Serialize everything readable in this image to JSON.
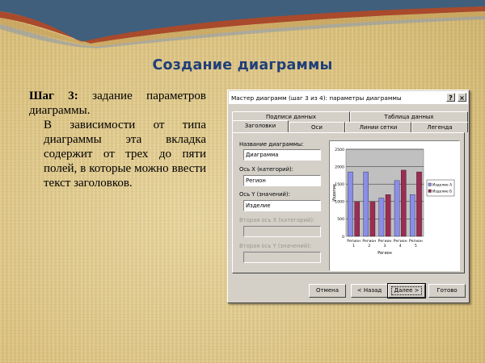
{
  "slide": {
    "title": "Создание диаграммы",
    "step_label": "Шаг 3:",
    "step_text": " задание параметров диаграммы.",
    "paragraph": "В зависимости от типа диаграммы эта вкладка содержит от трех до пяти полей, в которые можно ввести текст заголовков."
  },
  "dialog": {
    "title": "Мастер диаграмм (шаг 3 из 4): параметры диаграммы",
    "help_glyph": "?",
    "close_glyph": "×",
    "tabs_back": [
      "Подписи данных",
      "Таблица данных"
    ],
    "tabs_front": [
      "Заголовки",
      "Оси",
      "Линии сетки",
      "Легенда"
    ],
    "active_tab": "Заголовки",
    "fields": [
      {
        "label": "Название диаграммы:",
        "value": "Диаграмма",
        "enabled": true
      },
      {
        "label": "Ось X (категорий):",
        "value": "Регион",
        "enabled": true
      },
      {
        "label": "Ось Y (значений):",
        "value": "Изделие",
        "enabled": true
      },
      {
        "label": "Вторая ось X (категорий):",
        "value": "",
        "enabled": false
      },
      {
        "label": "Вторая ось Y (значений):",
        "value": "",
        "enabled": false
      }
    ],
    "buttons": {
      "cancel": "Отмена",
      "back": "< Назад",
      "next": "Далее >",
      "finish": "Готово"
    }
  },
  "colors": {
    "series_a": "#8a8ee8",
    "series_b": "#9b2d55",
    "plot_bg": "#c0c0c0"
  },
  "chart_data": {
    "type": "bar",
    "title": "",
    "xlabel": "Регион",
    "ylabel": "Изделие",
    "categories": [
      "Регион 1",
      "Регион 2",
      "Регион 3",
      "Регион 4",
      "Регион 5"
    ],
    "ylim": [
      0,
      2500
    ],
    "yticks": [
      "2500",
      "2000",
      "1500",
      "1000",
      "500",
      "0"
    ],
    "series": [
      {
        "name": "Изделие А",
        "values": [
          1850,
          1850,
          1100,
          1600,
          1200
        ]
      },
      {
        "name": "Изделие Б",
        "values": [
          1000,
          1000,
          1200,
          1900,
          1850
        ]
      }
    ],
    "legend": "right",
    "grid": true
  }
}
